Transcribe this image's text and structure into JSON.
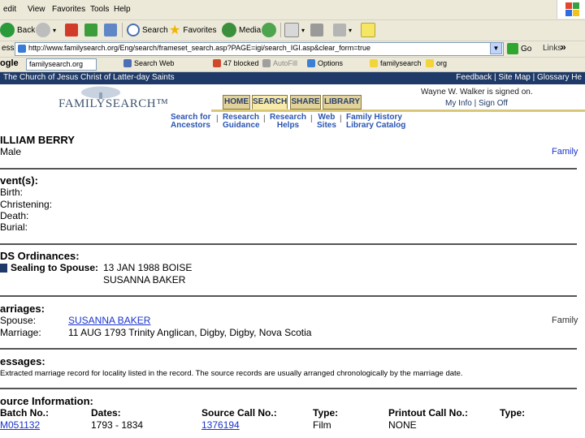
{
  "browser": {
    "menu": [
      "edit",
      "View",
      "Favorites",
      "Tools",
      "Help"
    ],
    "toolbar": {
      "back_label": "Back",
      "search_label": "Search",
      "favorites_label": "Favorites",
      "media_label": "Media"
    },
    "address": {
      "label": "ess",
      "url": "http://www.familysearch.org/Eng/search/frameset_search.asp?PAGE=igi/search_IGI.asp&clear_form=true",
      "go_label": "Go",
      "links_label": "Links"
    },
    "google": {
      "logo": "ogle",
      "search_value": "familysearch.org",
      "search_web": "Search Web",
      "blocked": "47 blocked",
      "autofill": "AutoFill",
      "options": "Options",
      "highlight_1": "familysearch",
      "highlight_2": "org"
    }
  },
  "site": {
    "church_name": "The Church of Jesus Christ of Latter-day Saints",
    "top_links": "Feedback  |  Site Map  |  Glossary    He",
    "logo_text": "FAMILYSEARCH™",
    "tabs": [
      "HOME",
      "SEARCH",
      "SHARE",
      "LIBRARY"
    ],
    "signed_on": "Wayne W. Walker is signed on.",
    "my_info": "My Info  |  Sign Off",
    "subnav": [
      {
        "line1": "Search for",
        "line2": "Ancestors"
      },
      {
        "line1": "Research",
        "line2": "Guidance"
      },
      {
        "line1": "Research",
        "line2": "Helps"
      },
      {
        "line1": "Web",
        "line2": "Sites"
      },
      {
        "line1": "Family History",
        "line2": "Library Catalog"
      }
    ]
  },
  "record": {
    "name": "ILLIAM BERRY",
    "sex": "Male",
    "family_link": "Family",
    "events_heading": "vent(s):",
    "events": [
      "Birth:",
      "Christening:",
      "Death:",
      "Burial:"
    ],
    "ordinances_heading": "DS Ordinances:",
    "sealing_label": "Sealing to Spouse:",
    "sealing_value": "13 JAN 1988  BOISE",
    "sealing_spouse": "SUSANNA BAKER",
    "marriages_heading": "arriages:",
    "spouse_label": "Spouse:",
    "spouse_value": "SUSANNA BAKER",
    "spouse_family": "Family",
    "marriage_label": "Marriage:",
    "marriage_value": "11 AUG 1793  Trinity Anglican, Digby, Digby, Nova Scotia",
    "messages_heading": "essages:",
    "messages_text": "Extracted marriage record for locality listed in the record. The source records are usually arranged chronologically by the marriage date.",
    "source_heading": "ource Information:",
    "source_columns": [
      "Batch No.:",
      "Dates:",
      "Source Call No.:",
      "Type:",
      "Printout Call No.:",
      "Type:"
    ],
    "source_values": [
      "M051132",
      "1793 - 1834",
      "1376194",
      "Film",
      "NONE",
      ""
    ]
  }
}
